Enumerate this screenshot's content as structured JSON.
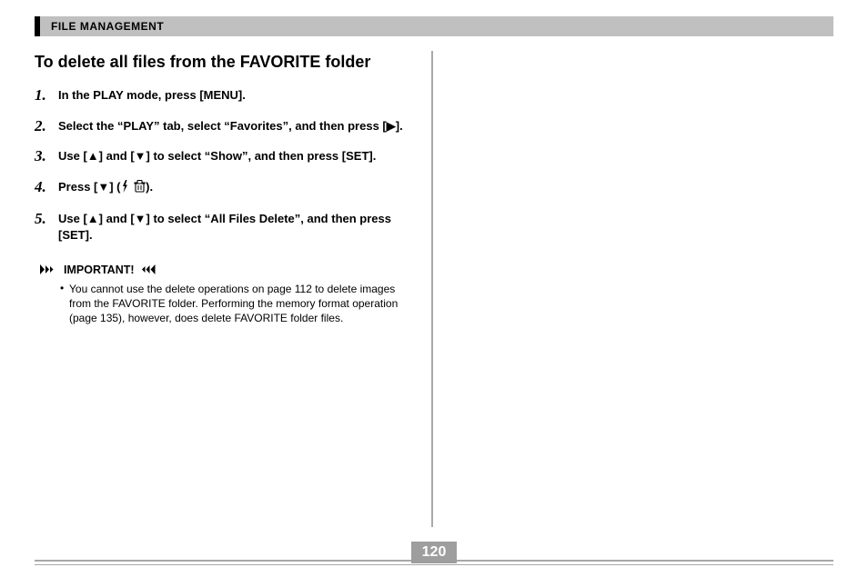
{
  "header": {
    "title": "FILE MANAGEMENT"
  },
  "section": {
    "title": "To delete all files from the FAVORITE folder",
    "steps": [
      "In the PLAY mode, press [MENU].",
      "Select the “PLAY” tab, select “Favorites”, and then press [▶].",
      "Use [▲] and [▼] to select “Show”, and then press [SET].",
      "__STEP4__",
      "Use [▲] and [▼] to select “All Files Delete”, and then press [SET]."
    ],
    "step4_prefix": "Press [▼] (",
    "step4_suffix": ")."
  },
  "important": {
    "label": "IMPORTANT!",
    "body": "You cannot use the delete operations on page 112 to delete images from the FAVORITE folder. Performing the memory format operation (page 135), however, does delete FAVORITE folder files."
  },
  "page_number": "120"
}
